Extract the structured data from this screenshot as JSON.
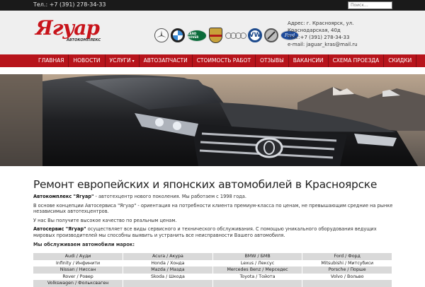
{
  "topbar": {
    "phone": "Тел.: +7 (391) 278-34-33",
    "search_placeholder": "Поиск..."
  },
  "logo": {
    "name": "Ягуар",
    "subtitle": "АВТОКОМПЛЕКС"
  },
  "brands": [
    "mercedes-icon",
    "bmw-icon",
    "land-rover-icon",
    "porsche-icon",
    "audi-icon",
    "volkswagen-icon",
    "volvo-icon",
    "ford-icon"
  ],
  "brand_logo_texts": {
    "land_rover": "LAND ROVER",
    "volkswagen": "VW",
    "ford": "Ford"
  },
  "contacts": {
    "address": "Адрес: г. Красноярск, ул. Краснодарская, 40д",
    "phone": "Тел.:+7 (391) 278-34-33",
    "email": "e-mail: jaguar_kras@mail.ru"
  },
  "nav": [
    "ГЛАВНАЯ",
    "НОВОСТИ",
    "УСЛУГИ",
    "АВТОЗАПЧАСТИ",
    "СТОИМОСТЬ РАБОТ",
    "ОТЗЫВЫ",
    "ВАКАНСИИ",
    "СХЕМА ПРОЕЗДА",
    "СКИДКИ"
  ],
  "colors": {
    "brand_red": "#b7141b",
    "logo_red": "#c8141b",
    "topbar": "#1a1a1a",
    "header_bg": "#efefef"
  },
  "content": {
    "title": "Ремонт европейских и японских автомобилей в Красноярске",
    "p1_bold": "Автокомплекс \"Ягуар\"",
    "p1_rest": " - автотехцентр нового поколения. Мы работаем с 1998 года.",
    "p2": "В основе концепции Автосервиса \"Ягуар\" - ориентация на потребности клиента премиум-класса по ценам, не превышающим средние на рынке независимых автотехцентров.",
    "p3": "У нас Вы получите высокое качество по реальным ценам.",
    "p4_bold": "Автосервис \"Ягуар\"",
    "p4_rest": " осуществляет все виды сервисного и технического обслуживания. С помощью уникального оборудования ведущих мировых производителей мы способны выявить и устранить все неисправности Вашего автомобиля.",
    "models_label": "Мы обслуживаем автомобили марок:"
  },
  "models": [
    [
      "Audi / Ауди",
      "Acura / Акура",
      "BMW / БМВ",
      "Ford / Форд"
    ],
    [
      "Infinity / Инфинити",
      "Honda / Хонда",
      "Lexus / Лексус",
      "Mitsubishi / Митсубиси"
    ],
    [
      "Nissan / Ниссан",
      "Mazda / Мазда",
      "Mercedes Benz / Мерседес",
      "Porsche / Порше"
    ],
    [
      "Rover / Ровер",
      "Skoda / Шкода",
      "Toyota / Тойота",
      "Volvo / Вольво"
    ],
    [
      "Volkswagen / Фольксваген",
      "",
      "",
      ""
    ]
  ]
}
